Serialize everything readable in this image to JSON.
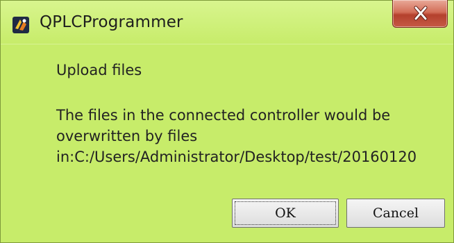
{
  "window": {
    "title": "QPLCProgrammer",
    "background_color": "#c7ec6a",
    "close_icon": "close-icon",
    "app_icon": "qplc-app-icon"
  },
  "dialog": {
    "heading": "Upload files",
    "message": "The files in the connected controller would be\noverwritten by files\nin:C:/Users/Administrator/Desktop/test/20160120",
    "buttons": {
      "ok_label": "OK",
      "cancel_label": "Cancel"
    }
  }
}
